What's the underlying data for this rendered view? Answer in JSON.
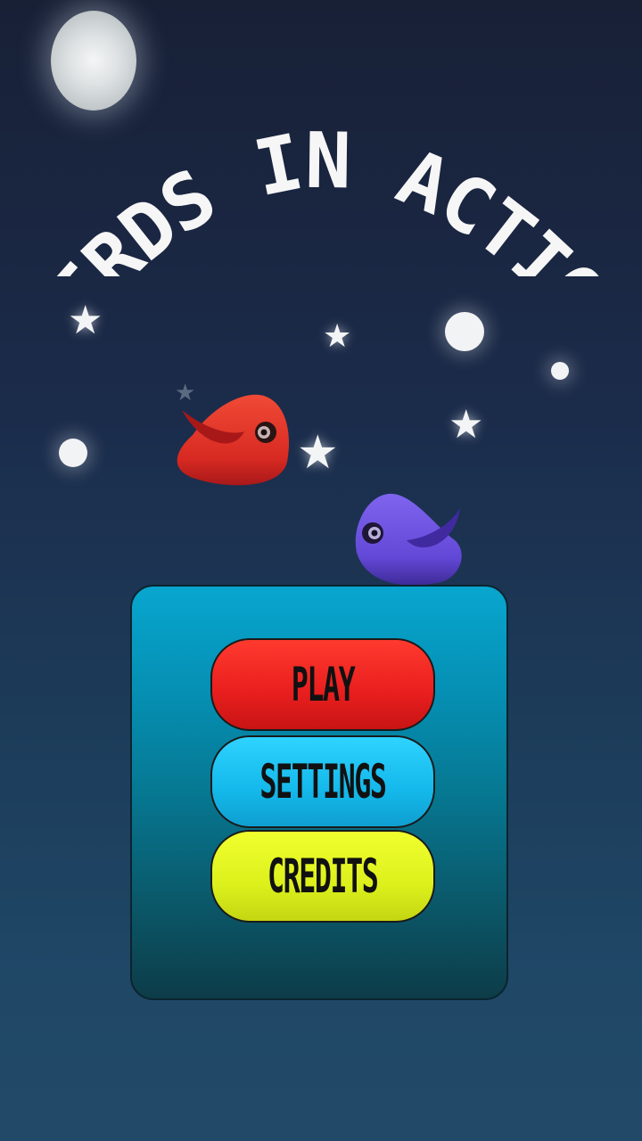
{
  "game": {
    "title": "Birds In Action"
  },
  "menu": {
    "play_label": "Play",
    "settings_label": "Settings",
    "credits_label": "Credits"
  },
  "colors": {
    "sky_top": "#182036",
    "sky_bottom": "#224a68",
    "panel": "#067892",
    "play": "#e81e1e",
    "settings": "#14b8ea",
    "credits": "#dcf01c",
    "red_bird": "#e8362b",
    "purple_bird": "#6a52e0"
  },
  "icons": [
    "moon-icon",
    "star-icon",
    "red-bird-icon",
    "purple-bird-icon"
  ]
}
